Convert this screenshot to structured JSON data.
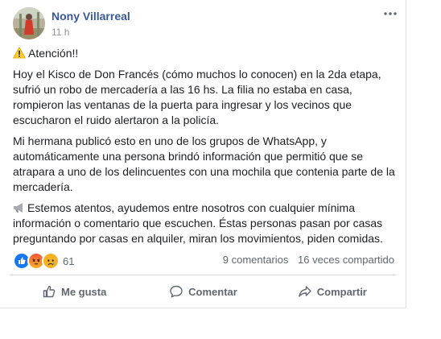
{
  "post": {
    "author": "Nony Villarreal",
    "time": "11 h",
    "more_icon": "ellipsis-icon",
    "heading": "Atención!!",
    "paragraphs": [
      "Hoy el Kisco de Don Francés (cómo muchos lo conocen) en la 2da etapa, sufrió un robo de mercadería a las 16 hs. La filia no estaba en casa, rompieron las ventanas de la puerta para ingresar y los vecinos que escucharon el ruido alertaron a la policía.",
      "Mi hermana publicó esto en uno de los grupos de WhatsApp, y automáticamente una persona brindó información que permitió que se atrapara a uno de los delincuentes con una mochila que contenia parte de la mercadería."
    ],
    "last_paragraph": "Estemos atentos, ayudemos entre nosotros con cualquier mínima información o comentario que escuchen. Éstas personas pasan por casas preguntando por casas en alquiler, miran los movimientos, piden comidas."
  },
  "reactions": {
    "types": [
      "like",
      "angry",
      "sad"
    ],
    "count": "61",
    "comments": "9 comentarios",
    "shares": "16 veces compartido"
  },
  "actions": {
    "like": "Me gusta",
    "comment": "Comentar",
    "share": "Compartir"
  },
  "colors": {
    "author_link": "#385898",
    "secondary_text": "#606770",
    "like_blue": "#1877f2",
    "angry_orange": "#f0543c",
    "sad_yellow": "#f7b125"
  }
}
